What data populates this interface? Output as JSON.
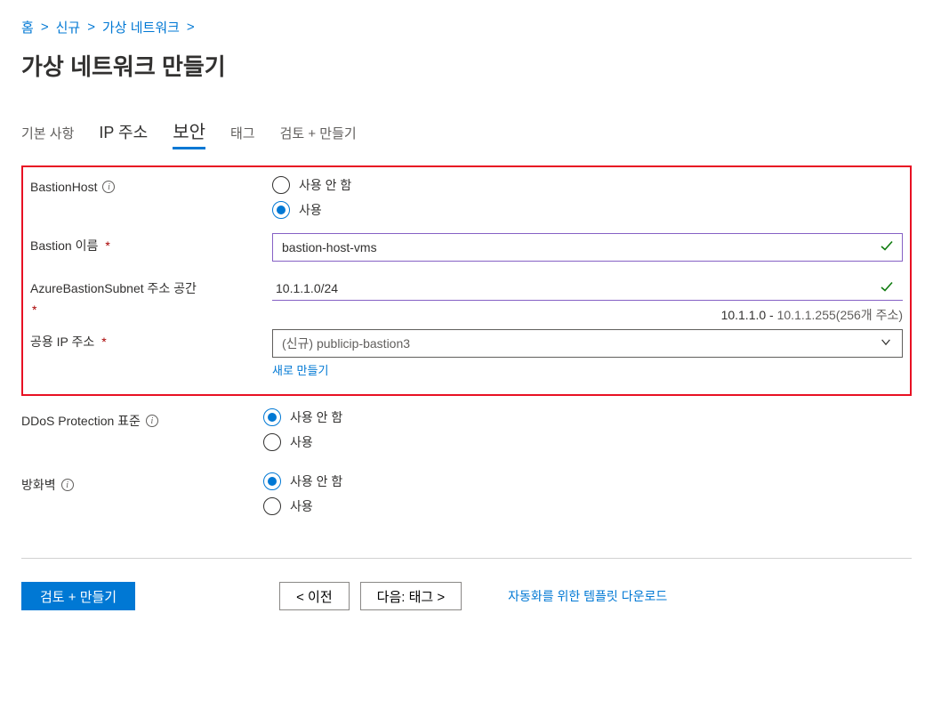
{
  "breadcrumb": {
    "home": "홈",
    "new": "신규",
    "vnet": "가상 네트워크"
  },
  "page_title": "가상 네트워크 만들기",
  "tabs": {
    "basics": "기본 사항",
    "ip": "IP 주소",
    "security": "보안",
    "tags": "태그",
    "review": "검토 + 만들기"
  },
  "labels": {
    "bastion_host": "BastionHost",
    "bastion_name": "Bastion 이름",
    "bastion_subnet": "AzureBastionSubnet 주소 공간",
    "public_ip": "공용 IP 주소",
    "ddos": "DDoS Protection 표준",
    "firewall": "방화벽"
  },
  "radio": {
    "disable": "사용 안 함",
    "enable": "사용"
  },
  "values": {
    "bastion_name": "bastion-host-vms",
    "subnet": "10.1.1.0/24",
    "subnet_range_start": "10.1.1.0 - ",
    "subnet_range_end": "10.1.1.255(256개 주소)",
    "public_ip": "(신규) publicip-bastion3"
  },
  "links": {
    "create_new": "새로 만들기",
    "download_template": "자동화를 위한 템플릿 다운로드"
  },
  "footer": {
    "review_create": "검토 + 만들기",
    "previous": "< 이전",
    "next": "다음: 태그 >"
  }
}
